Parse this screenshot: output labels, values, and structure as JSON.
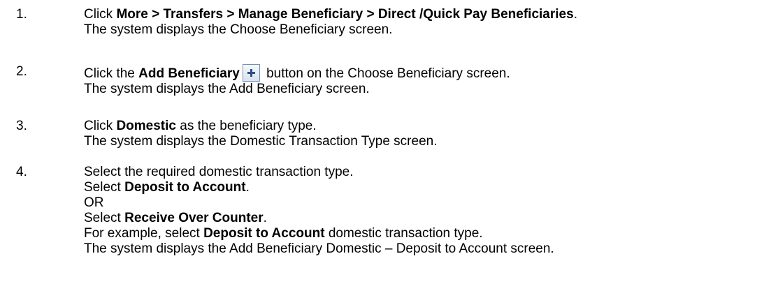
{
  "steps": [
    {
      "number": "1.",
      "lines": [
        {
          "before": "Click ",
          "bold": "More > Transfers > Manage Beneficiary > Direct /Quick Pay Beneficiaries",
          "after": "."
        },
        {
          "text": "The system displays the Choose Beneficiary screen."
        }
      ]
    },
    {
      "number": "2.",
      "lines": [
        {
          "before": "Click the ",
          "bold": "Add Beneficiary",
          "after": " button on the Choose Beneficiary screen."
        },
        {
          "text": "The system displays the Add Beneficiary screen."
        }
      ],
      "icon": "add-plus-icon"
    },
    {
      "number": "3.",
      "lines": [
        {
          "before": "Click ",
          "bold": "Domestic",
          "after": " as the beneficiary type."
        },
        {
          "text": "The system displays the Domestic Transaction Type screen."
        }
      ]
    },
    {
      "number": "4.",
      "lines": [
        {
          "text": "Select the required domestic transaction type."
        },
        {
          "before": "Select ",
          "bold": "Deposit to Account",
          "after": "."
        },
        {
          "text": "OR"
        },
        {
          "before": "Select ",
          "bold": "Receive Over Counter",
          "after": "."
        },
        {
          "before": "For example, select ",
          "bold": "Deposit to Account",
          "after": " domestic transaction type."
        },
        {
          "text": "The system displays the Add Beneficiary Domestic – Deposit to Account screen."
        }
      ]
    }
  ],
  "colors": {
    "text": "#000000",
    "icon_border": "#6f8fb5",
    "icon_plus": "#2a4f86"
  }
}
